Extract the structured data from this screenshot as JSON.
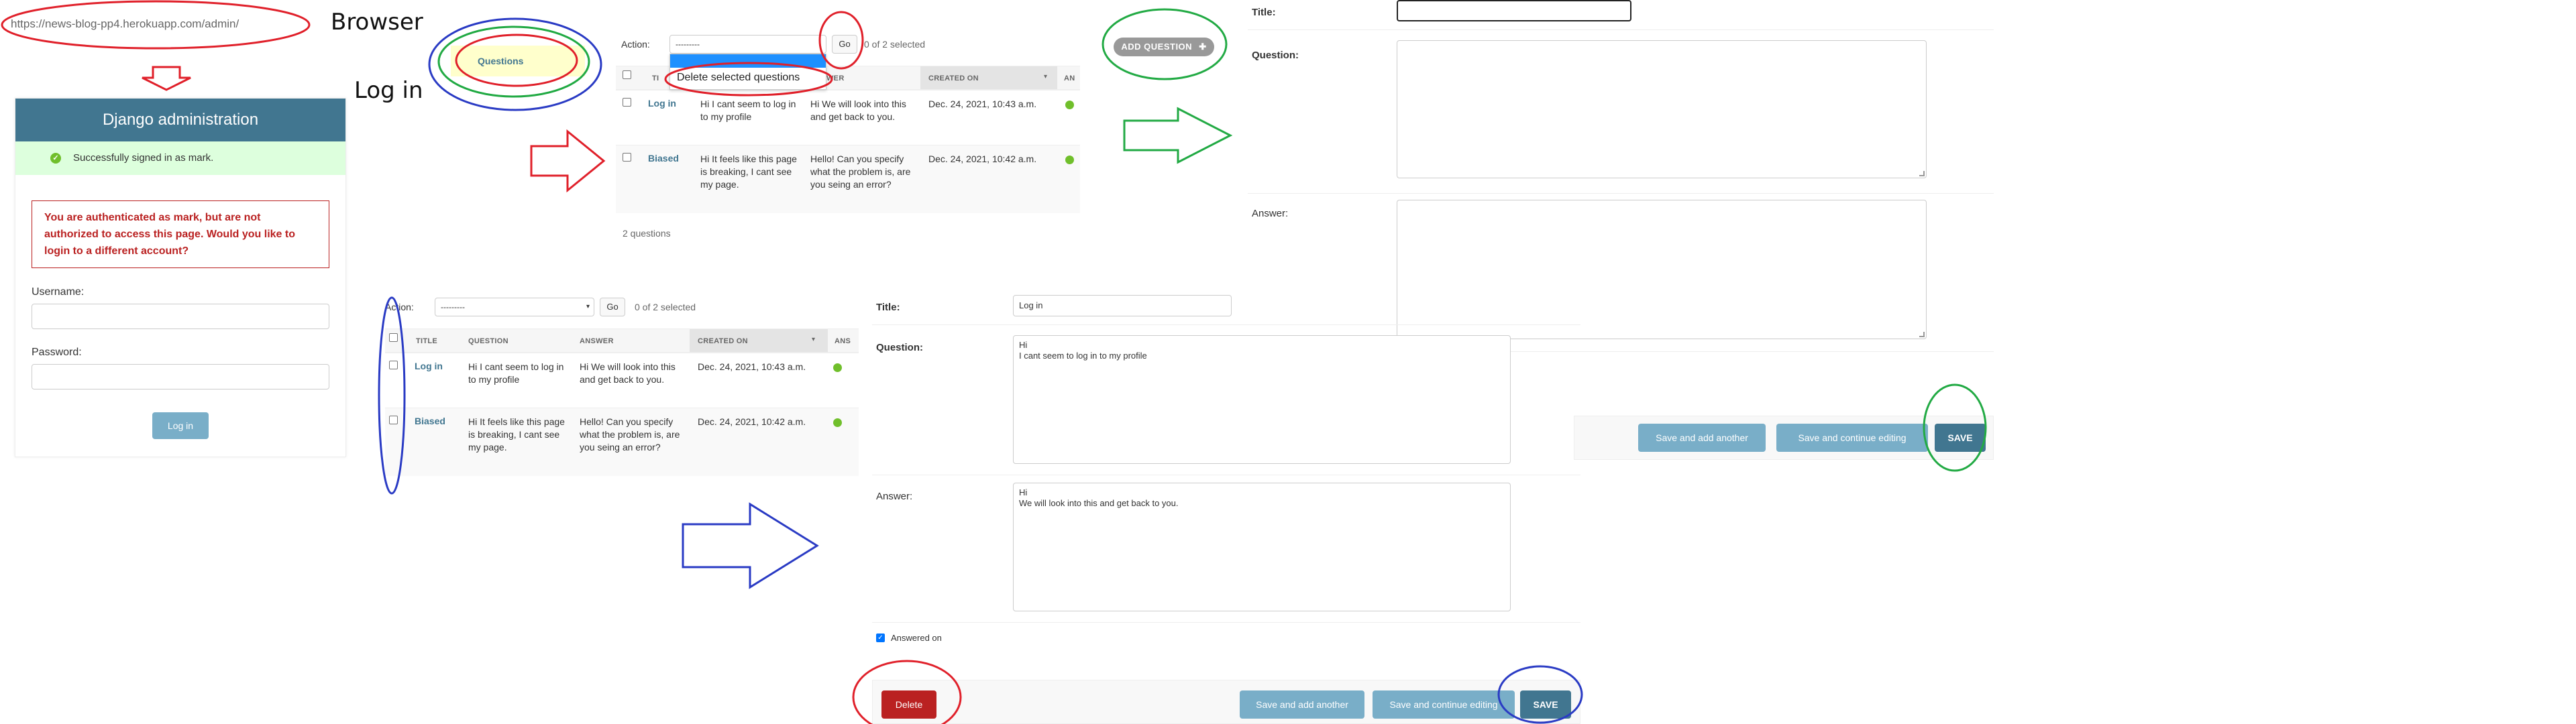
{
  "browser": {
    "url": "https://news-blog-pp4.herokuapp.com/admin/",
    "label": "Browser",
    "login_label": "Log in"
  },
  "login": {
    "header": "Django administration",
    "success_message": "Successfully signed in as mark.",
    "error_message": "You are authenticated as mark, but are not authorized to access this page. Would you like to login to a different account?",
    "username_label": "Username:",
    "password_label": "Password:",
    "login_button": "Log in"
  },
  "nav": {
    "questions": "Questions"
  },
  "changelist_top": {
    "action_label": "Action:",
    "action_value": "---------",
    "go_label": "Go",
    "selected": "0 of 2 selected",
    "menu_option": "Delete selected questions",
    "col_question_partial": "TI",
    "col_answer_partial": "WER",
    "col_created": "CREATED ON",
    "col_ans_partial": "AN",
    "count": "2 questions"
  },
  "changelist_bottom": {
    "action_label": "Action:",
    "action_value": "---------",
    "go_label": "Go",
    "selected": "0 of 2 selected",
    "col_title": "TITLE",
    "col_question": "QUESTION",
    "col_answer": "ANSWER",
    "col_created": "CREATED ON",
    "col_ans_partial": "ANS"
  },
  "rows": [
    {
      "title": "Log in",
      "question": "Hi I cant seem to log in to my profile",
      "answer": "Hi We will look into this and get back to you.",
      "created": "Dec. 24, 2021, 10:43 a.m."
    },
    {
      "title": "Biased",
      "question": "Hi It feels like this page is breaking, I cant see my page.",
      "answer": "Hello! Can you specify what the problem is, are you seing an error?",
      "created": "Dec. 24, 2021, 10:42 a.m."
    }
  ],
  "add_form": {
    "add_button": "ADD QUESTION",
    "title_label": "Title:",
    "question_label": "Question:",
    "answer_label": "Answer:",
    "save_add_another": "Save and add another",
    "save_continue": "Save and continue editing",
    "save": "SAVE"
  },
  "edit_form": {
    "title_label": "Title:",
    "title_value": "Log in",
    "question_label": "Question:",
    "question_value": "Hi\nI cant seem to log in to my profile",
    "answer_label": "Answer:",
    "answer_value": "Hi\nWe will look into this and get back to you.",
    "answered_label": "Answered on",
    "delete": "Delete",
    "save_add_another": "Save and add another",
    "save_continue": "Save and continue editing",
    "save": "SAVE"
  },
  "colors": {
    "header_blue": "#417690",
    "button_blue": "#79aec8",
    "delete_red": "#ba2121",
    "success_green": "#dfd",
    "annotation_red": "#e0202a",
    "annotation_green": "#22aa44",
    "annotation_blue": "#2a3bc4"
  }
}
